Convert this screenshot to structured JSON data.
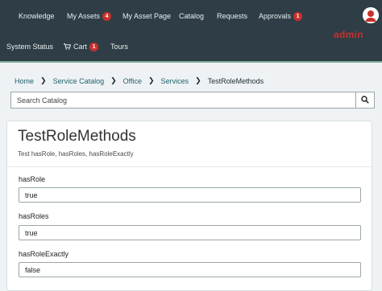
{
  "nav": {
    "items": [
      {
        "label": "Knowledge"
      },
      {
        "label": "My Assets",
        "badge": "4"
      },
      {
        "label": "My Asset Page"
      },
      {
        "label": "Catalog"
      },
      {
        "label": "Requests"
      },
      {
        "label": "Approvals",
        "badge": "1"
      },
      {
        "label": "System Status"
      },
      {
        "label": "Cart",
        "badge": "1"
      },
      {
        "label": "Tours"
      }
    ],
    "user": "admin"
  },
  "breadcrumb": [
    "Home",
    "Service Catalog",
    "Office",
    "Services",
    "TestRoleMethods"
  ],
  "search": {
    "placeholder": "Search Catalog"
  },
  "item": {
    "title": "TestRoleMethods",
    "description": "Test hasRole, hasRoles, hasRoleExactly",
    "fields": [
      {
        "label": "hasRole",
        "value": "true"
      },
      {
        "label": "hasRoles",
        "value": "true"
      },
      {
        "label": "hasRoleExactly",
        "value": "false"
      }
    ]
  },
  "colors": {
    "nav_bg": "#2f3e46",
    "badge": "#c9302c",
    "accent_line": "#7fb09a",
    "link": "#1f5f6d"
  }
}
